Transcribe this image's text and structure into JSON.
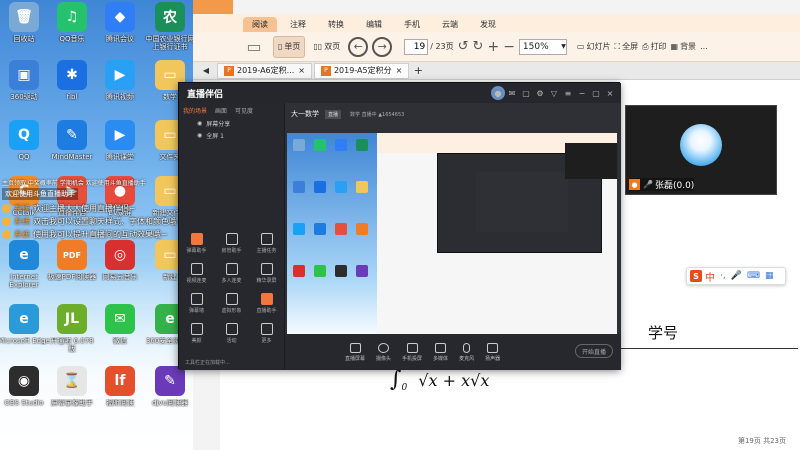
{
  "desktop": {
    "icons": [
      {
        "label": "回收站",
        "glyph": "🗑",
        "color": "#7aa9d6",
        "col": 0,
        "row": 0
      },
      {
        "label": "QQ音乐",
        "glyph": "♫",
        "color": "#25c26e",
        "col": 1,
        "row": 0
      },
      {
        "label": "腾讯会议",
        "glyph": "◆",
        "color": "#2f7ef5",
        "col": 2,
        "row": 0
      },
      {
        "label": "中国农业银行网上银行证书",
        "glyph": "农",
        "color": "#1b8f5a",
        "col": 3,
        "row": 0
      },
      {
        "label": "360驱动",
        "glyph": "▣",
        "color": "#3b7fd8",
        "col": 0,
        "row": 1
      },
      {
        "label": "flbl",
        "glyph": "✱",
        "color": "#1c6fe0",
        "col": 1,
        "row": 1
      },
      {
        "label": "腾讯视频",
        "glyph": "▶",
        "color": "#2aa0f5",
        "col": 2,
        "row": 1
      },
      {
        "label": "数学",
        "glyph": "▭",
        "color": "#f1c75b",
        "col": 3,
        "row": 1
      },
      {
        "label": "QQ",
        "glyph": "Q",
        "color": "#1aa0f5",
        "col": 0,
        "row": 2
      },
      {
        "label": "MindMaster",
        "glyph": "✎",
        "color": "#1e7be0",
        "col": 1,
        "row": 2
      },
      {
        "label": "腾讯课堂",
        "glyph": "▶",
        "color": "#2a8cf0",
        "col": 2,
        "row": 2
      },
      {
        "label": "文件夹",
        "glyph": "▭",
        "color": "#f1c75b",
        "col": 3,
        "row": 2
      },
      {
        "label": "CCtalk",
        "glyph": "C",
        "color": "#f08c2a",
        "col": 0,
        "row": 3
      },
      {
        "label": "直播伴侣",
        "glyph": "▶",
        "color": "#e5503a",
        "col": 1,
        "row": 3
      },
      {
        "label": "EV录屏",
        "glyph": "●",
        "color": "#e84a3c",
        "col": 2,
        "row": 3
      },
      {
        "label": "新建文件夹",
        "glyph": "▭",
        "color": "#f1c75b",
        "col": 3,
        "row": 3
      },
      {
        "label": "Internet Explorer",
        "glyph": "e",
        "color": "#1f88d8",
        "col": 0,
        "row": 4
      },
      {
        "label": "极速PDF阅读器",
        "glyph": "PDF",
        "color": "#f07c28",
        "col": 1,
        "row": 4
      },
      {
        "label": "网易云音乐",
        "glyph": "◎",
        "color": "#d8302f",
        "col": 2,
        "row": 4
      },
      {
        "label": "新建",
        "glyph": "▭",
        "color": "#f1c75b",
        "col": 3,
        "row": 4
      },
      {
        "label": "Microsoft Edge",
        "glyph": "e",
        "color": "#2a9bd8",
        "col": 0,
        "row": 5
      },
      {
        "label": "开通啦 6.078 版",
        "glyph": "JL",
        "color": "#6cae2a",
        "col": 1,
        "row": 5
      },
      {
        "label": "微信",
        "glyph": "✉",
        "color": "#2dc24a",
        "col": 2,
        "row": 5
      },
      {
        "label": "360安全浏览器",
        "glyph": "e",
        "color": "#34b24a",
        "col": 3,
        "row": 5
      },
      {
        "label": "OBS Studio",
        "glyph": "◉",
        "color": "#2d2d2d",
        "col": 0,
        "row": 6
      },
      {
        "label": "屏幕录像助手",
        "glyph": "⌛",
        "color": "#e6e6e6",
        "col": 1,
        "row": 6
      },
      {
        "label": "福昕阅读",
        "glyph": "lf",
        "color": "#e5502c",
        "col": 2,
        "row": 6
      },
      {
        "label": "djvu阅读器",
        "glyph": "✎",
        "color": "#6a3ab8",
        "col": 3,
        "row": 6
      }
    ],
    "chat": {
      "system_line": "主页领取 中奖概率前 学期机会 欢迎使用斗鱼直播助手",
      "system_line2": "欢迎使用斗鱼直播助手",
      "messages": [
        {
          "name": "系统",
          "text": "欢迎主播大大使用直播伴侣~"
        },
        {
          "name": "系统",
          "text": "双击我可以设置聊天样式、字体和颜色哦~"
        },
        {
          "name": "系统",
          "text": "使用我可以提升直播间的互动效果哦~"
        }
      ]
    }
  },
  "pdf": {
    "menu": [
      "阅读",
      "注释",
      "转换",
      "编辑",
      "手机",
      "云端",
      "发现"
    ],
    "toolbar": {
      "single_page": "单页",
      "double_page": "双页",
      "page_current": "19",
      "page_total": "/ 23页",
      "zoom": "150%",
      "slideshow": "幻灯片",
      "fullscreen": "全屏",
      "print": "打印",
      "background": "背景",
      "more": "..."
    },
    "tabs": [
      {
        "label": "2019-A6定积...",
        "active": false
      },
      {
        "label": "2019-A5定积分",
        "active": true
      }
    ],
    "page": {
      "formula_lower": "0",
      "formula_body": "√x + x√x",
      "xuehao": "学号",
      "footer": "第19页 共23页"
    }
  },
  "camera": {
    "name": "张磊(0.0)"
  },
  "ime": {
    "lang": "中",
    "icons": [
      "mic-icon",
      "keyboard-icon",
      "grid-icon"
    ]
  },
  "zhibo": {
    "logo": "直播伴侣",
    "left_tabs": [
      "我的场景",
      "画面",
      "可见度"
    ],
    "scenes": [
      "屏幕分享",
      "全屏 1"
    ],
    "tools": [
      {
        "label": "弹幕助手",
        "hot": true
      },
      {
        "label": "房管助手",
        "hot": false
      },
      {
        "label": "主播任务",
        "hot": false
      },
      {
        "label": "视频连麦",
        "hot": false
      },
      {
        "label": "多人连麦",
        "hot": false
      },
      {
        "label": "精华录屏",
        "hot": false
      },
      {
        "label": "弹幕墙",
        "hot": false
      },
      {
        "label": "虚拟形象",
        "hot": false
      },
      {
        "label": "直播助手",
        "hot": true
      },
      {
        "label": "美颜",
        "hot": false
      },
      {
        "label": "活动",
        "hot": false
      },
      {
        "label": "更多",
        "hot": false
      }
    ],
    "loading": "工具栏正在加载中...",
    "info": {
      "title": "大一数学",
      "badge": "直播",
      "meta": "数学 直播中 ▲1654653"
    },
    "bottom": [
      "直播屏幕",
      "摄像头",
      "手机投屏",
      "多媒体",
      "麦克风",
      "扬声器"
    ],
    "start_button": "开始直播"
  }
}
